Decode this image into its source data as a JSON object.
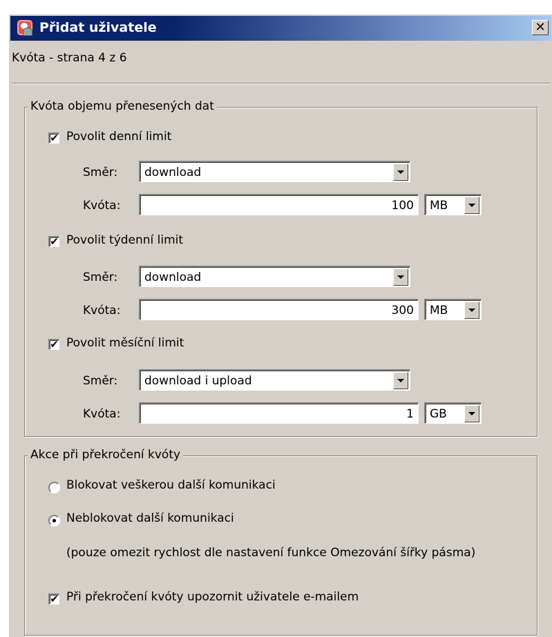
{
  "window": {
    "title": "Přidat uživatele",
    "close_symbol": "✕",
    "icon": "user-add-icon"
  },
  "header": {
    "page_label": "Kvóta - strana 4 z 6"
  },
  "transfer_quota": {
    "legend": "Kvóta objemu přenesených dat",
    "daily": {
      "enable_label": "Povolit denní limit",
      "enabled": true,
      "direction_label": "Směr:",
      "direction_value": "download",
      "quota_label": "Kvóta:",
      "quota_value": "100",
      "unit": "MB"
    },
    "weekly": {
      "enable_label": "Povolit týdenní limit",
      "enabled": true,
      "direction_label": "Směr:",
      "direction_value": "download",
      "quota_label": "Kvóta:",
      "quota_value": "300",
      "unit": "MB"
    },
    "monthly": {
      "enable_label": "Povolit měsíční limit",
      "enabled": true,
      "direction_label": "Směr:",
      "direction_value": "download i upload",
      "quota_label": "Kvóta:",
      "quota_value": "1",
      "unit": "GB"
    }
  },
  "exceed_action": {
    "legend": "Akce při překročení kvóty",
    "block_label": "Blokovat veškerou další komunikaci",
    "noblock_label": "Neblokovat další komunikaci",
    "selected": "noblock",
    "note": "(pouze omezit rychlost dle nastavení funkce Omezování šířky pásma)",
    "email_label": "Při překročení kvóty upozornit uživatele e-mailem",
    "email_enabled": true
  },
  "check_mark": "✔"
}
